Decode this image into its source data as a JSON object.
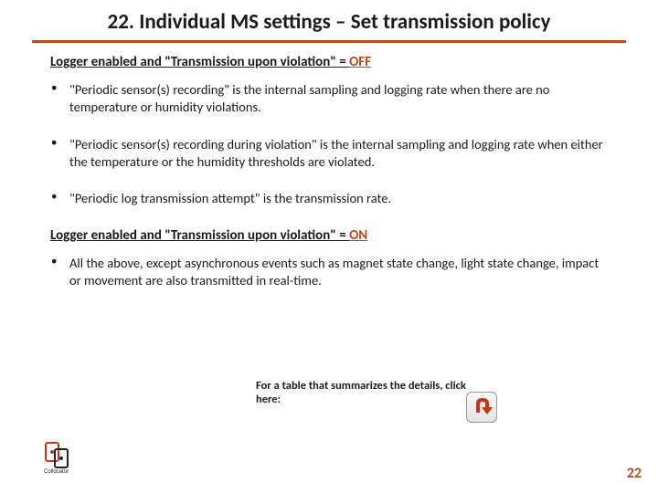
{
  "title": "22. Individual MS settings – Set transmission policy",
  "section_off": {
    "label_prefix": "Logger enabled and \"Transmission upon violation\" = ",
    "state": "OFF"
  },
  "bullets_off": [
    "\"Periodic sensor(s) recording\" is the internal sampling and logging rate when there are no temperature or humidity violations.",
    "\"Periodic sensor(s) recording during violation\" is the internal sampling and logging rate when either the temperature or the humidity thresholds are violated.",
    "\"Periodic log transmission attempt\" is the transmission rate."
  ],
  "section_on": {
    "label_prefix": "Logger enabled and \"Transmission upon violation\" = ",
    "state": "ON"
  },
  "bullets_on": [
    "All the above, except asynchronous events such as magnet state change, light state change, impact or movement are also transmitted in real-time."
  ],
  "note": "For a table that summarizes the details, click here:",
  "page_number": "22"
}
